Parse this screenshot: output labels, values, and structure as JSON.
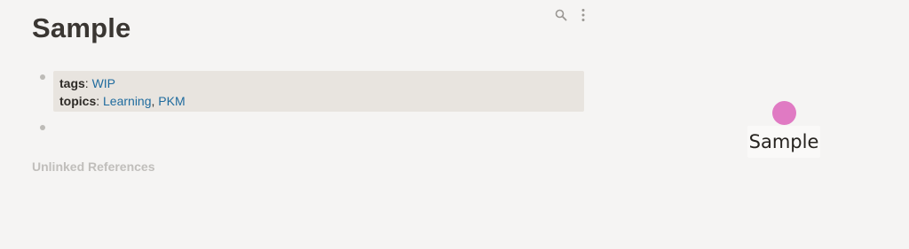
{
  "page": {
    "title": "Sample"
  },
  "toolbar": {
    "icons": [
      "search-icon",
      "more-vertical-icon"
    ]
  },
  "properties": {
    "tags_key": "tags",
    "tags_value": "WIP",
    "topics_key": "topics",
    "topics_values": [
      "Learning",
      "PKM"
    ],
    "separator": ":",
    "list_separator": ","
  },
  "references": {
    "unlinked_label": "Unlinked References"
  },
  "graph": {
    "node_label": "Sample",
    "node_color": "#e07ac3"
  },
  "colors": {
    "background": "#f5f4f3",
    "property_box": "#e8e4df",
    "link": "#1f6b9e",
    "muted": "#c0bebb"
  }
}
